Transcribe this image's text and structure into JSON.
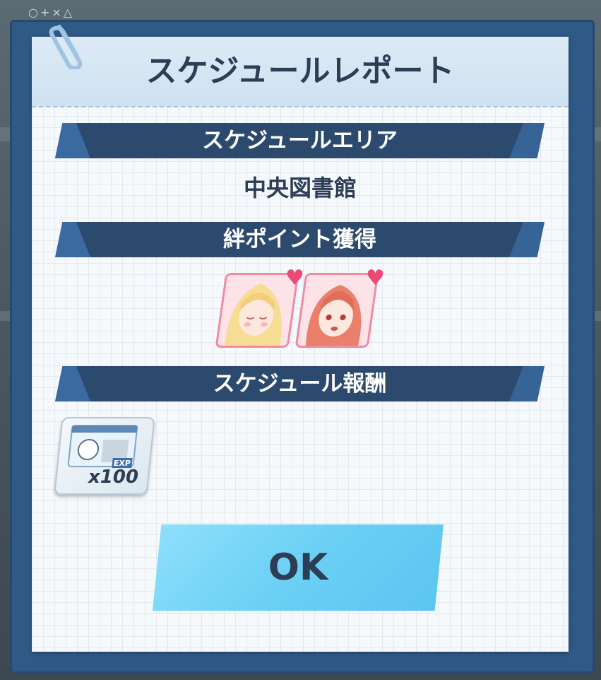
{
  "background": {
    "deco_symbols": "○+×△"
  },
  "dialog": {
    "title": "スケジュールレポート",
    "sections": {
      "area": {
        "label": "スケジュールエリア",
        "value": "中央図書館"
      },
      "bond": {
        "label": "絆ポイント獲得",
        "characters": [
          "blonde-student-portrait",
          "redhead-student-portrait"
        ]
      },
      "reward": {
        "label": "スケジュール報酬",
        "item_name": "exp-report-icon",
        "item_badge": "EXP",
        "count": "x100"
      }
    },
    "ok_button": "OK"
  },
  "colors": {
    "frame": "#2f5a86",
    "section_bar": "#2c4a6e",
    "ok_button": "#6cd0f5",
    "heart": "#ea4a78",
    "title_text": "#2c3d55"
  }
}
